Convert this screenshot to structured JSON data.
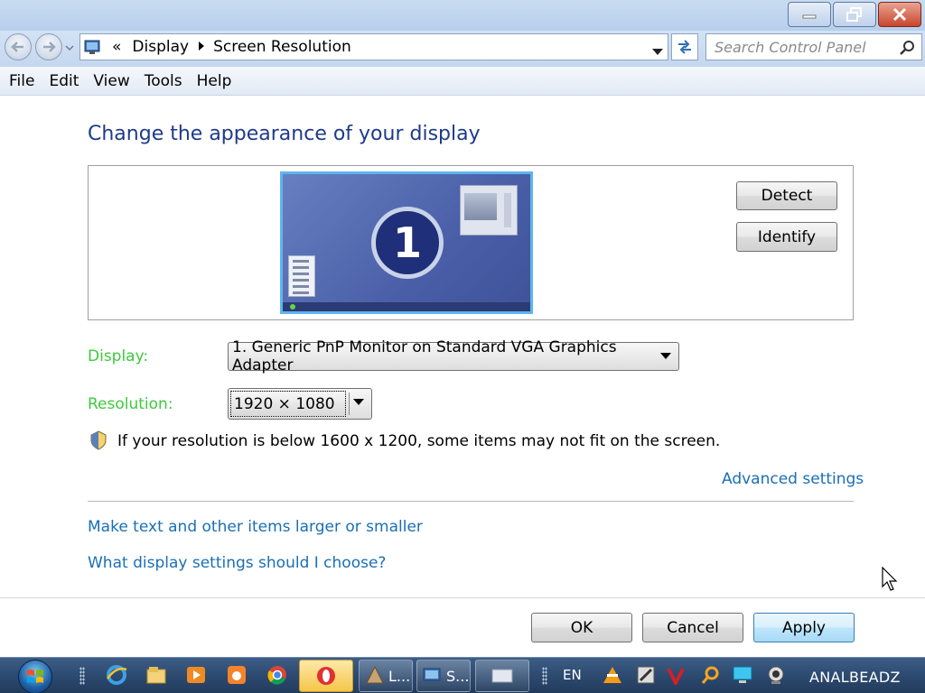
{
  "window": {
    "minimize_label": "minimize",
    "maximize_label": "restore",
    "close_label": "close"
  },
  "address": {
    "overflow": "«",
    "crumbs": [
      "Display",
      "Screen Resolution"
    ],
    "search_placeholder": "Search Control Panel"
  },
  "menu": [
    "File",
    "Edit",
    "View",
    "Tools",
    "Help"
  ],
  "main": {
    "title": "Change the appearance of your display",
    "monitor_number": "1",
    "detect_label": "Detect",
    "identify_label": "Identify",
    "display_label": "Display:",
    "display_value": "1. Generic PnP Monitor on Standard VGA Graphics Adapter",
    "resolution_label": "Resolution:",
    "resolution_value": "1920 × 1080",
    "warning_text": "If your resolution is below 1600 x 1200, some items may not fit on the screen.",
    "advanced_link": "Advanced settings",
    "larger_link": "Make text and other items larger or smaller",
    "which_link": "What display settings should I choose?",
    "label_color": "#3ec93e",
    "link_color": "#1a6fb5"
  },
  "footer": {
    "ok_label": "OK",
    "cancel_label": "Cancel",
    "apply_label": "Apply"
  },
  "taskbar": {
    "pinned_icons": [
      "ie-icon",
      "explorer-icon",
      "media-player-icon",
      "uc-browser-icon",
      "chrome-icon"
    ],
    "tasks": [
      {
        "name": "opera-task",
        "label": "",
        "active": true
      },
      {
        "name": "l-task",
        "label": "L..."
      },
      {
        "name": "screen-resolution-task",
        "label": "S..."
      },
      {
        "name": "blank-task",
        "label": ""
      }
    ],
    "language": "EN",
    "tray_icons": [
      "vlc-icon",
      "tool-icon",
      "v-icon",
      "search-tray-icon",
      "monitor-tray-icon",
      "webcam-icon"
    ],
    "username": "ANALBEADZ"
  }
}
